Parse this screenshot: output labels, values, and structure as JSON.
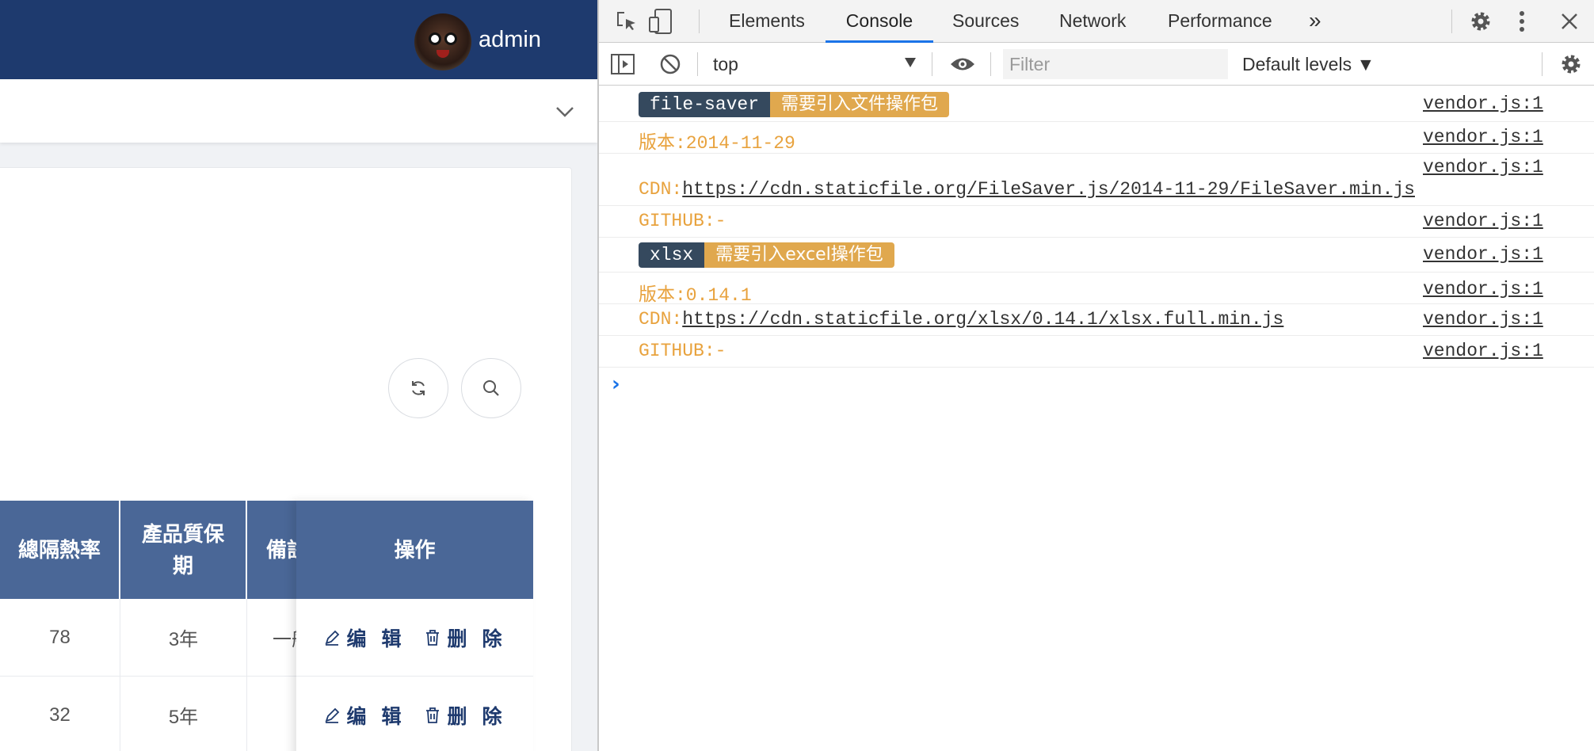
{
  "app": {
    "username": "admin",
    "table": {
      "headers": [
        "總隔熱率",
        "產品質保期",
        "備註",
        "操作"
      ],
      "rows": [
        {
          "rate": "78",
          "warranty": "3年",
          "note": "一般"
        },
        {
          "rate": "32",
          "warranty": "5年",
          "note": ""
        }
      ],
      "actions": {
        "edit": "编 辑",
        "delete": "删 除"
      }
    }
  },
  "devtools": {
    "tabs": [
      "Elements",
      "Console",
      "Sources",
      "Network",
      "Performance"
    ],
    "active_tab": "Console",
    "more_tabs": "»",
    "context": "top",
    "filter_placeholder": "Filter",
    "levels": "Default levels ▼",
    "logs": [
      {
        "type": "badge",
        "badge": "file-saver",
        "tag": "需要引入文件操作包",
        "src": "vendor.js:1"
      },
      {
        "type": "text",
        "text": "版本:2014-11-29",
        "src": "vendor.js:1"
      },
      {
        "type": "link",
        "prefix": "CDN:",
        "url": "https://cdn.staticfile.org/FileSaver.js/2014-11-29/FileSaver.min.js",
        "src": "vendor.js:1"
      },
      {
        "type": "text",
        "text": "GITHUB:-",
        "src": "vendor.js:1"
      },
      {
        "type": "badge",
        "badge": "xlsx",
        "tag": "需要引入excel操作包",
        "src": "vendor.js:1"
      },
      {
        "type": "text",
        "text": "版本:0.14.1",
        "src": "vendor.js:1"
      },
      {
        "type": "link",
        "prefix": "CDN:",
        "url": "https://cdn.staticfile.org/xlsx/0.14.1/xlsx.full.min.js",
        "src": "vendor.js:1"
      },
      {
        "type": "text",
        "text": "GITHUB:-",
        "src": "vendor.js:1"
      }
    ],
    "prompt": "›",
    "colors": {
      "log_orange": "#e8a23d",
      "badge_dark": "#35495e",
      "badge_orange": "#e0a84e",
      "accent": "#1a73e8"
    }
  }
}
